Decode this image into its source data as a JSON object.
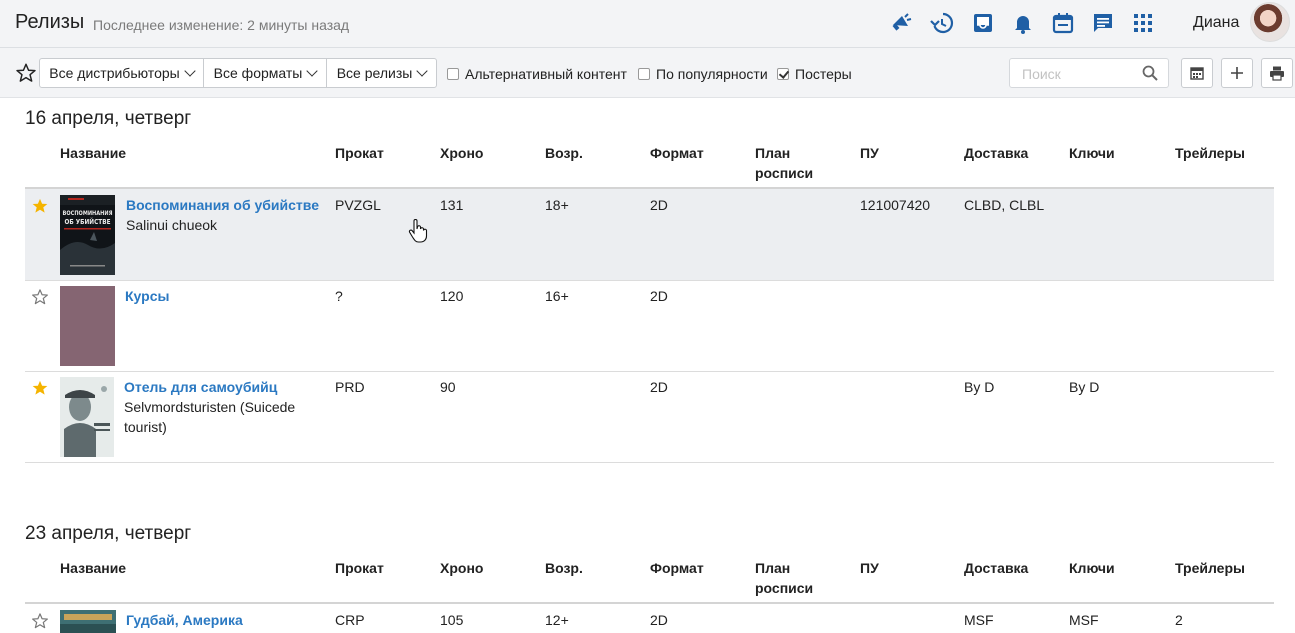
{
  "header": {
    "title": "Релизы",
    "subtitle": "Последнее изменение: 2 минуты назад",
    "icons": [
      "megaphone-icon",
      "history-icon",
      "inbox-icon",
      "bell-icon",
      "calendar-icon",
      "chat-icon",
      "apps-grid-icon"
    ],
    "user_name": "Диана",
    "accent": "#1f5fa5"
  },
  "toolbar": {
    "distributors_label": "Все дистрибьюторы",
    "formats_label": "Все форматы",
    "releases_label": "Все релизы",
    "alt_content_label": "Альтернативный контент",
    "alt_content_checked": false,
    "popularity_label": "По популярности",
    "popularity_checked": false,
    "posters_label": "Постеры",
    "posters_checked": true,
    "search_placeholder": "Поиск"
  },
  "columns": {
    "name": "Название",
    "distribution": "Прокат",
    "duration": "Хроно",
    "age": "Возр.",
    "format": "Формат",
    "plan_line1": "План",
    "plan_line2": "росписи",
    "pu": "ПУ",
    "delivery": "Доставка",
    "keys": "Ключи",
    "trailers": "Трейлеры"
  },
  "groups": [
    {
      "date": "16 апреля, четверг",
      "rows": [
        {
          "starred": true,
          "title": "Воспоминания об убийстве",
          "original": "Salinui chueok",
          "distribution": "PVZGL",
          "duration": "131",
          "age": "18+",
          "format": "2D",
          "plan": "",
          "pu": "121007420",
          "delivery": "CLBD, CLBL",
          "keys": "",
          "trailers": "",
          "poster_text_1": "ВОСПОМИНАНИЯ",
          "poster_text_2": "ОБ УБИЙСТВЕ"
        },
        {
          "starred": false,
          "title": "Курсы",
          "original": "",
          "distribution": "?",
          "duration": "120",
          "age": "16+",
          "format": "2D",
          "plan": "",
          "pu": "",
          "delivery": "",
          "keys": "",
          "trailers": ""
        },
        {
          "starred": true,
          "title": "Отель для самоубийц",
          "original_line1": "Selvmordsturisten (Suicede",
          "original_line2": "tourist)",
          "distribution": "PRD",
          "duration": "90",
          "age": "",
          "format": "2D",
          "plan": "",
          "pu": "",
          "delivery": "By D",
          "keys": "By D",
          "trailers": ""
        }
      ]
    },
    {
      "date": "23 апреля, четверг",
      "rows": [
        {
          "starred": false,
          "title": "Гудбай, Америка",
          "original": "",
          "distribution": "CRP",
          "duration": "105",
          "age": "12+",
          "format": "2D",
          "plan": "",
          "pu": "",
          "delivery": "MSF",
          "keys": "MSF",
          "trailers": "2"
        }
      ]
    }
  ],
  "colors": {
    "link": "#2b79c2",
    "star_active": "#f5b400",
    "row_highlight": "#eceef1"
  }
}
